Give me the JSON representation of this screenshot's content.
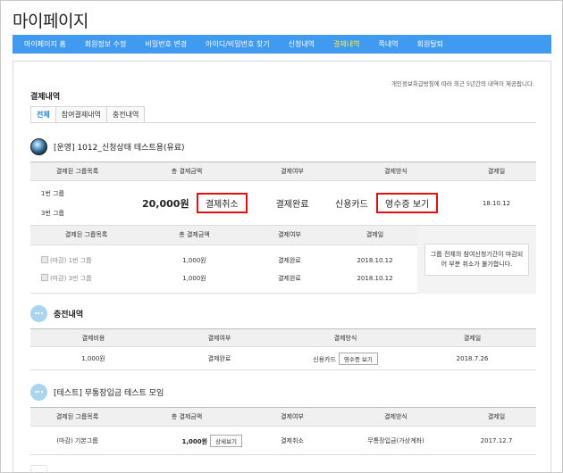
{
  "page": {
    "title": "마이페이지"
  },
  "nav": {
    "items": [
      {
        "label": "마이페이지 홈"
      },
      {
        "label": "회원정보 수정"
      },
      {
        "label": "비밀번호 변경"
      },
      {
        "label": "아이디/비밀번호 찾기"
      },
      {
        "label": "신청내역"
      },
      {
        "label": "결제내역"
      },
      {
        "label": "쪽내역"
      },
      {
        "label": "회원탈퇴"
      }
    ],
    "active_color": "#ffe84d",
    "bar_color": "#3f9af0"
  },
  "content": {
    "privacy_note": "개인정보취급방침에 따라 최근 5년간의 내역이 제공됩니다.",
    "section_title": "결제내역",
    "tabs": [
      {
        "label": "전체"
      },
      {
        "label": "참여결제내역"
      },
      {
        "label": "충전내역"
      }
    ]
  },
  "group1": {
    "name": "[운영] 1012_신청상태 테스트용(유료)",
    "headers": [
      "결제된 그룹목록",
      "총 결제금액",
      "결제여부",
      "결제방식",
      "결제일"
    ],
    "row": {
      "group_a": "1번 그룹",
      "group_b": "3번 그룹",
      "amount": "20,000원",
      "cancel_label": "결제취소",
      "status": "결제완료",
      "method": "신용카드",
      "receipt_label": "영수증 보기",
      "date": "18.10.12"
    },
    "sub": {
      "headers": [
        "결제된 그룹목록",
        "총 결제금액",
        "결제여부",
        "결제일"
      ],
      "rows": [
        {
          "group": "(마감) 1번 그룹",
          "amount": "1,000원",
          "status": "결제완료",
          "date": "2018.10.12"
        },
        {
          "group": "(마감) 3번 그룹",
          "amount": "1,000원",
          "status": "결제완료",
          "date": "2018.10.12"
        }
      ],
      "notice": "그룹 전체의 참여신청기간이 마감되어 부분 취소가 불가합니다."
    }
  },
  "charge": {
    "name": "충전내역",
    "headers": [
      "결제비용",
      "결제여부",
      "결제방식",
      "결제일"
    ],
    "row": {
      "cost": "1,000원",
      "status": "결제완료",
      "method": "신용카드",
      "receipt_label": "영수증 보기",
      "date": "2018.7.26"
    }
  },
  "group2": {
    "name": "[테스트] 무통장입금 테스트 모임",
    "headers": [
      "결제된 그룹목록",
      "총 결제금액",
      "결제여부",
      "결제방식",
      "결제일"
    ],
    "row": {
      "group": "(마감) 기본그룹",
      "amount": "1,000원",
      "detail_label": "상세보기",
      "status": "결제취소",
      "method": "무통장입금(가상계좌)",
      "date": "2017.12.7"
    }
  }
}
